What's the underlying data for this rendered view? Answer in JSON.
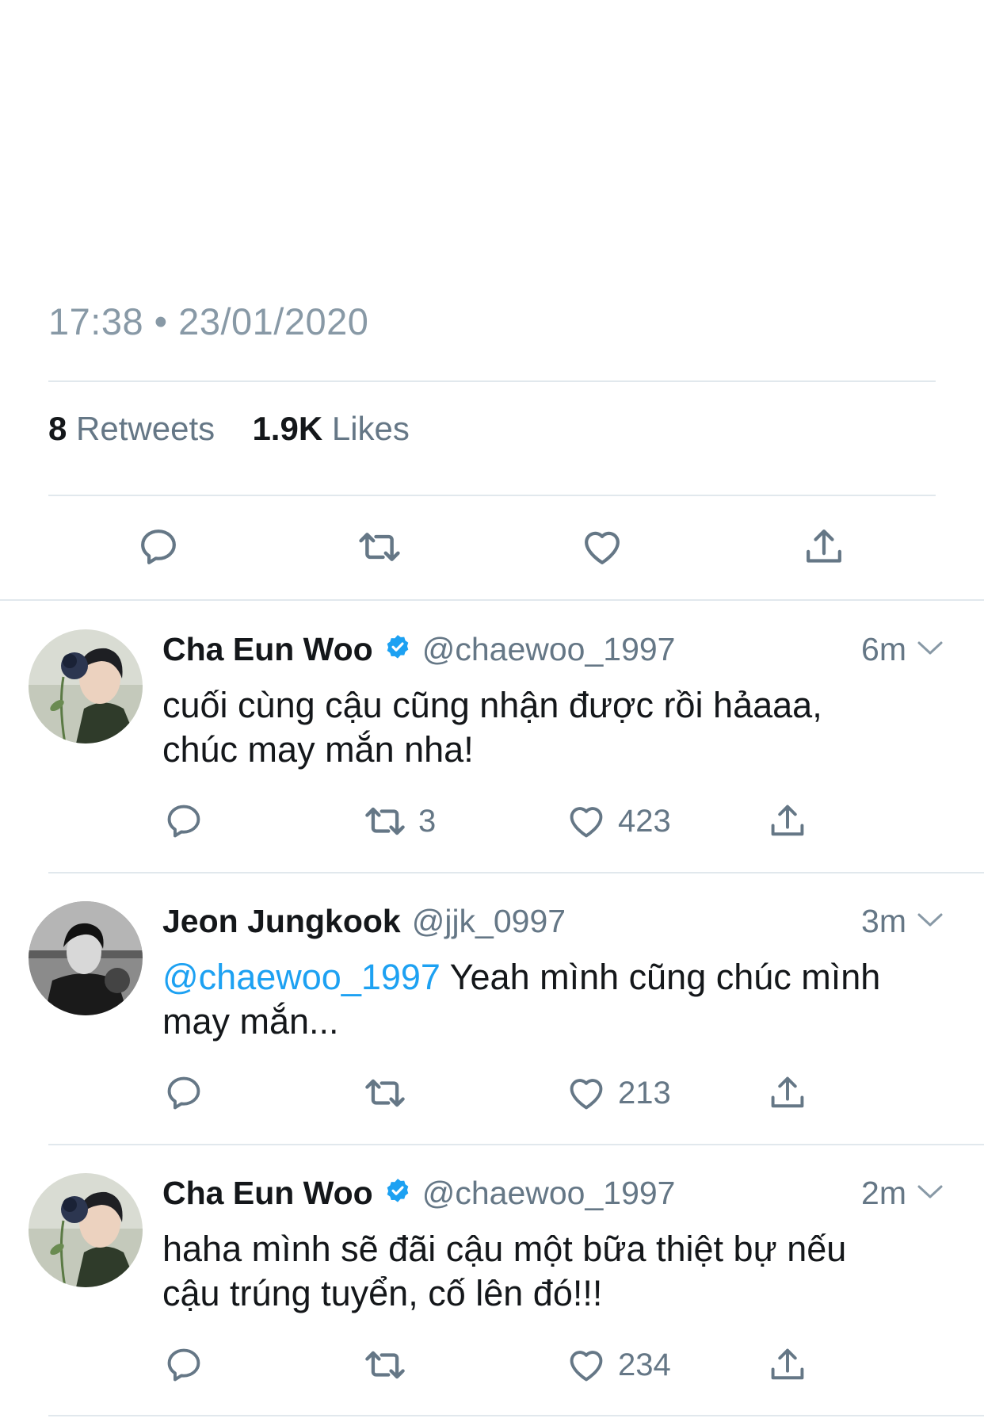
{
  "main_tweet": {
    "timestamp": "17:38 • 23/01/2020",
    "retweets_count": "8",
    "retweets_label": "Retweets",
    "likes_count": "1.9K",
    "likes_label": "Likes"
  },
  "replies": [
    {
      "name": "Cha Eun Woo",
      "verified": true,
      "handle": "@chaewoo_1997",
      "time": "6m",
      "text_line1": "cuối cùng cậu cũng nhận được rồi hảaaa,",
      "text_line2": "chúc may mắn nha!",
      "retweets": "3",
      "likes": "423"
    },
    {
      "name": "Jeon Jungkook",
      "verified": false,
      "handle": "@jjk_0997",
      "time": "3m",
      "mention": "@chaewoo_1997",
      "text_line1": " Yeah mình cũng chúc mình",
      "text_line2": "may mắn...",
      "retweets": "",
      "likes": "213"
    },
    {
      "name": "Cha Eun Woo",
      "verified": true,
      "handle": "@chaewoo_1997",
      "time": "2m",
      "text_line1": "haha mình sẽ đãi cậu một bữa thiệt bự nếu",
      "text_line2": "cậu trúng tuyển, cố lên đó!!!",
      "retweets": "",
      "likes": "234"
    }
  ],
  "colors": {
    "accent": "#1da1f2",
    "secondary_text": "#657786",
    "divider": "#e1e8ed"
  },
  "icons": [
    "reply-icon",
    "retweet-icon",
    "like-icon",
    "share-icon",
    "verified-badge-icon",
    "chevron-down-icon"
  ]
}
